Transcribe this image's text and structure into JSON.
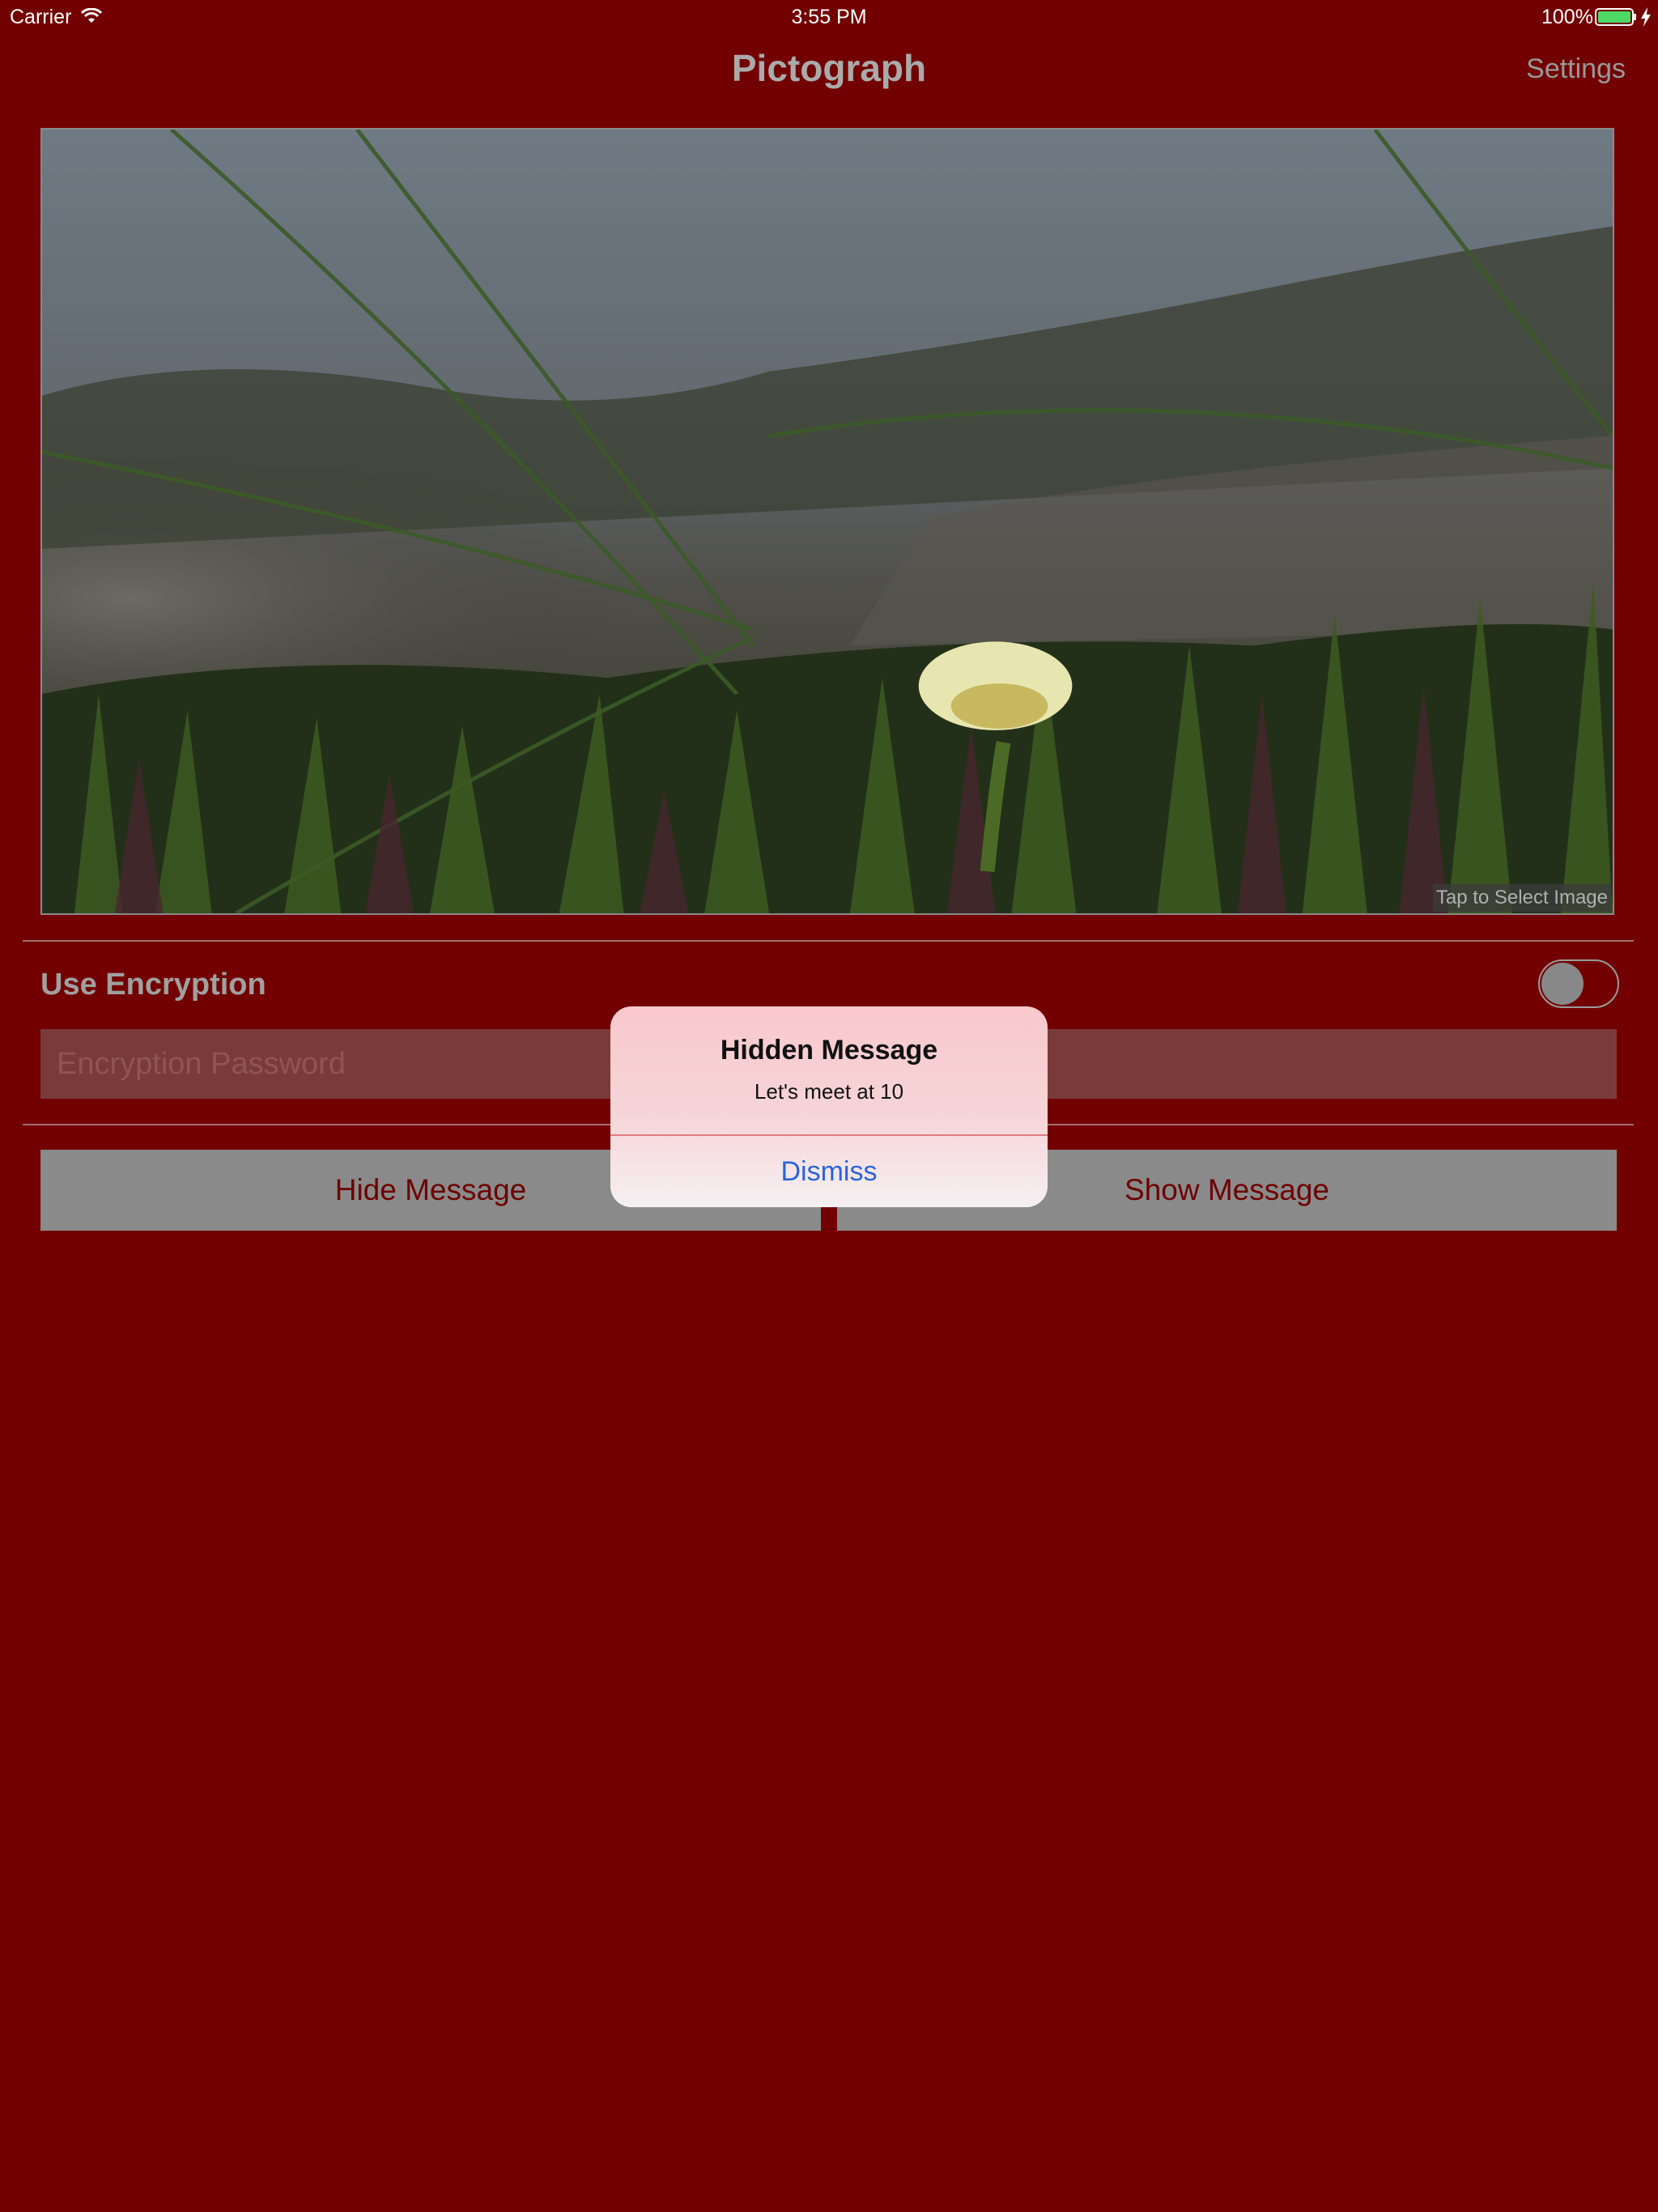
{
  "status_bar": {
    "carrier": "Carrier",
    "time": "3:55 PM",
    "battery": "100%",
    "wifi_icon": "wifi-icon",
    "battery_icon": "battery-icon",
    "charging_icon": "charging-bolt-icon"
  },
  "nav": {
    "title": "Pictograph",
    "settings_label": "Settings"
  },
  "image_picker": {
    "hint": "Tap to Select Image"
  },
  "encryption": {
    "label": "Use Encryption",
    "enabled": false,
    "password_placeholder": "Encryption Password"
  },
  "actions": {
    "hide_label": "Hide Message",
    "show_label": "Show Message"
  },
  "alert": {
    "title": "Hidden Message",
    "message": "Let's meet at 10",
    "dismiss_label": "Dismiss"
  },
  "colors": {
    "background": "#720000",
    "button_text": "#6e0000",
    "alert_action": "#2b64d9",
    "battery_fill": "#4cd964"
  }
}
